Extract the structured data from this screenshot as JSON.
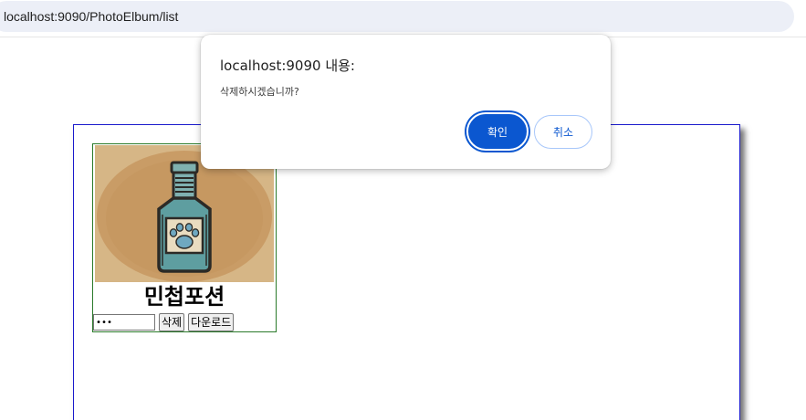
{
  "browser": {
    "url": "localhost:9090/PhotoElbum/list"
  },
  "album": {
    "photo": {
      "title": "민첩포션",
      "image_icon": "potion-bottle-paw-icon",
      "password_value": "•••",
      "delete_label": "삭제",
      "download_label": "다운로드"
    }
  },
  "dialog": {
    "title": "localhost:9090 내용:",
    "message": "삭제하시겠습니까?",
    "ok_label": "확인",
    "cancel_label": "취소"
  },
  "colors": {
    "accent": "#0b57d0",
    "container_border": "#1a1acc",
    "card_border": "#2a7a2a"
  }
}
